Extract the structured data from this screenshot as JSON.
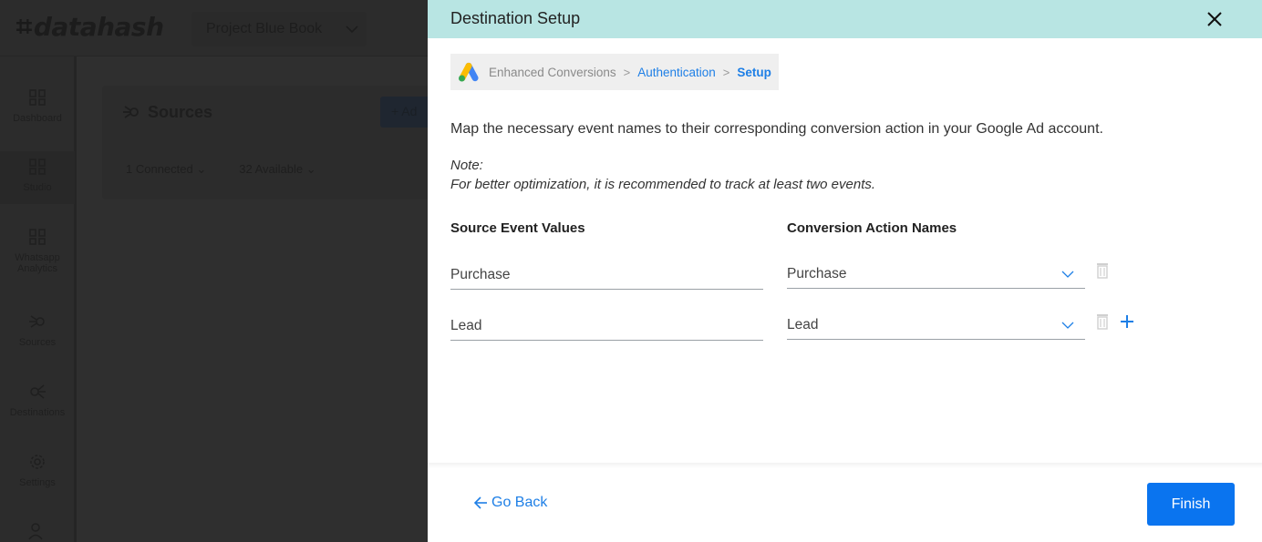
{
  "app": {
    "logo_text": "datahash",
    "project_name": "Project Blue Book"
  },
  "sidebar": {
    "items": [
      {
        "label": "Dashboard",
        "icon": "grid-icon"
      },
      {
        "label": "Studio",
        "icon": "grid-icon"
      },
      {
        "label": "Whatsapp Analytics",
        "icon": "grid-icon"
      },
      {
        "label": "Sources",
        "icon": "sources-icon"
      },
      {
        "label": "Destinations",
        "icon": "destinations-icon"
      },
      {
        "label": "Settings",
        "icon": "gear-icon"
      },
      {
        "label": "",
        "icon": "users-icon"
      }
    ]
  },
  "main": {
    "title": "Sources",
    "add_label": "+ Ad",
    "tabs": [
      "1 Connected",
      "32 Available"
    ]
  },
  "drawer": {
    "title": "Destination Setup",
    "breadcrumb": [
      "Enhanced Conversions",
      "Authentication",
      "Setup"
    ],
    "intro": "Map the necessary event names to their corresponding conversion action in your Google Ad account.",
    "note_label": "Note:",
    "note_text": "For better optimization, it is recommended to track at least two events.",
    "columns": {
      "source": "Source Event Values",
      "conversion": "Conversion Action Names"
    },
    "rows": [
      {
        "source_value": "Purchase",
        "conversion_value": "Purchase"
      },
      {
        "source_value": "Lead",
        "conversion_value": "Lead"
      }
    ],
    "go_back_label": "Go Back",
    "finish_label": "Finish"
  },
  "colors": {
    "header_bg": "#b8e5e3",
    "accent": "#1e7fe6",
    "primary_button": "#0a74ef",
    "overlay_bg": "#2f2f2f"
  }
}
